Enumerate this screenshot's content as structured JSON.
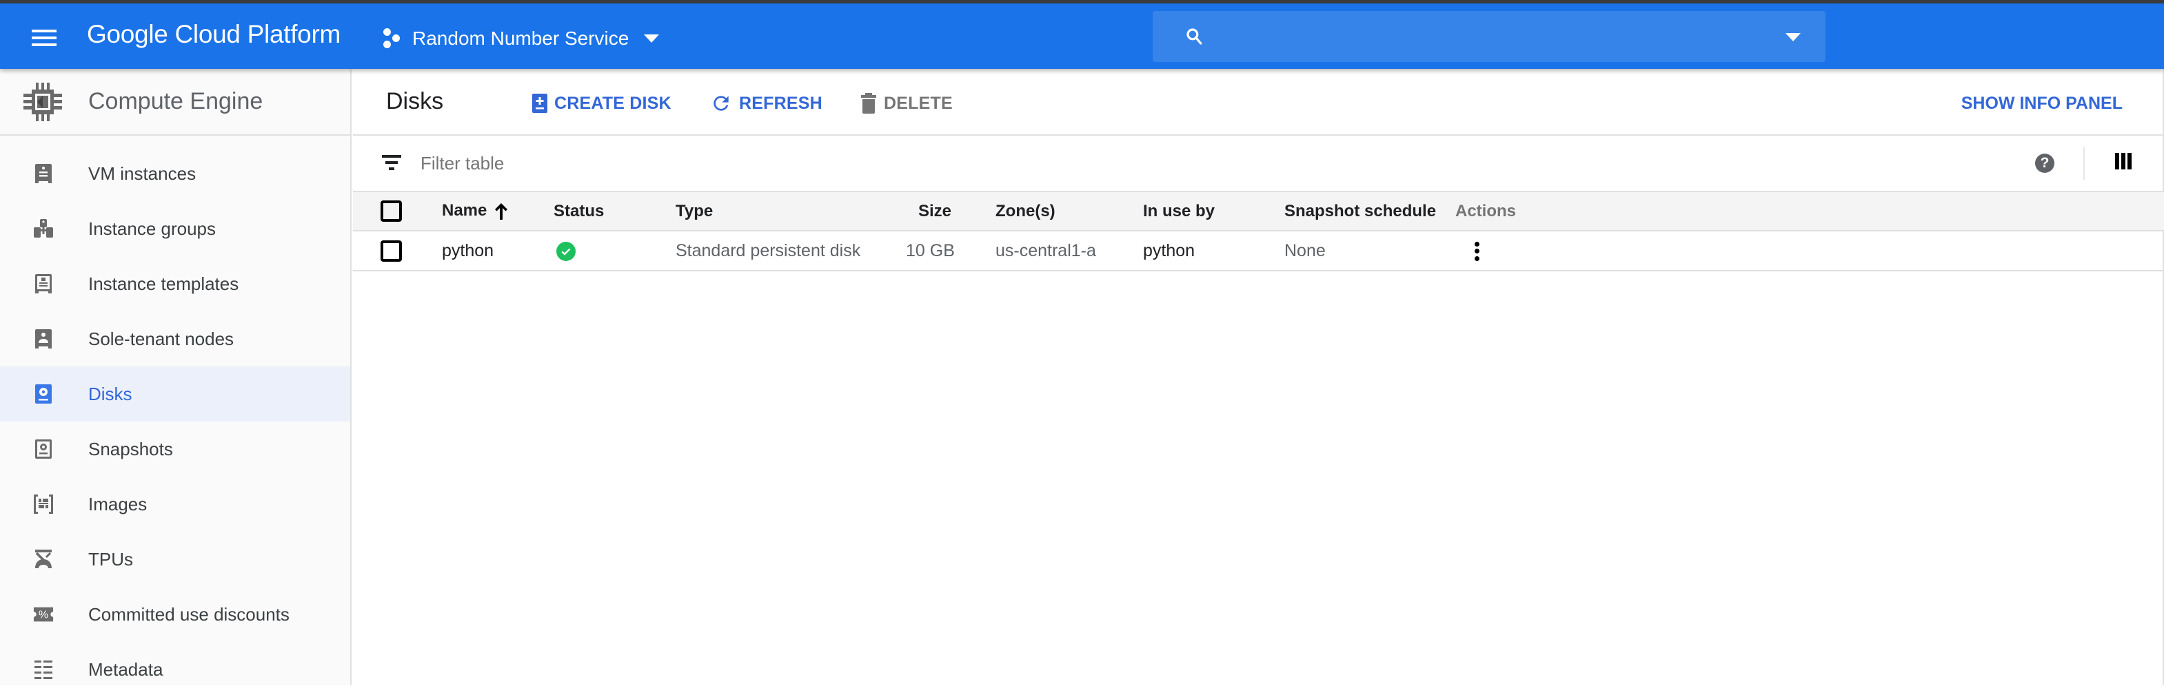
{
  "topbar": {
    "brand": "Google Cloud Platform",
    "project_name": "Random Number Service",
    "search_placeholder": "",
    "search_value": ""
  },
  "sidebar": {
    "product_title": "Compute Engine",
    "items": [
      {
        "label": "VM instances",
        "icon": "vm-instance-icon",
        "active": false
      },
      {
        "label": "Instance groups",
        "icon": "instance-groups-icon",
        "active": false
      },
      {
        "label": "Instance templates",
        "icon": "instance-templates-icon",
        "active": false
      },
      {
        "label": "Sole-tenant nodes",
        "icon": "sole-tenant-icon",
        "active": false
      },
      {
        "label": "Disks",
        "icon": "disk-icon",
        "active": true
      },
      {
        "label": "Snapshots",
        "icon": "snapshot-icon",
        "active": false
      },
      {
        "label": "Images",
        "icon": "images-icon",
        "active": false
      },
      {
        "label": "TPUs",
        "icon": "tpu-icon",
        "active": false
      },
      {
        "label": "Committed use discounts",
        "icon": "percent-icon",
        "active": false
      },
      {
        "label": "Metadata",
        "icon": "metadata-icon",
        "active": false
      }
    ]
  },
  "toolbar": {
    "page_title": "Disks",
    "create_label": "CREATE DISK",
    "refresh_label": "REFRESH",
    "delete_label": "DELETE",
    "info_panel_label": "SHOW INFO PANEL"
  },
  "filter": {
    "placeholder": "Filter table",
    "value": ""
  },
  "table": {
    "columns": {
      "name": "Name",
      "status": "Status",
      "type": "Type",
      "size": "Size",
      "zones": "Zone(s)",
      "in_use_by": "In use by",
      "snapshot_schedule": "Snapshot schedule",
      "actions": "Actions"
    },
    "sort": {
      "column": "Name",
      "direction": "ascending"
    },
    "rows": [
      {
        "name": "python",
        "status": "ready",
        "type": "Standard persistent disk",
        "size": "10 GB",
        "zones": "us-central1-a",
        "in_use_by": "python",
        "snapshot_schedule": "None"
      }
    ]
  },
  "colors": {
    "brand_blue": "#1a73e8",
    "accent_blue": "#3367d6",
    "status_green": "#1ec05d",
    "active_nav_bg": "#ebf0fa"
  }
}
